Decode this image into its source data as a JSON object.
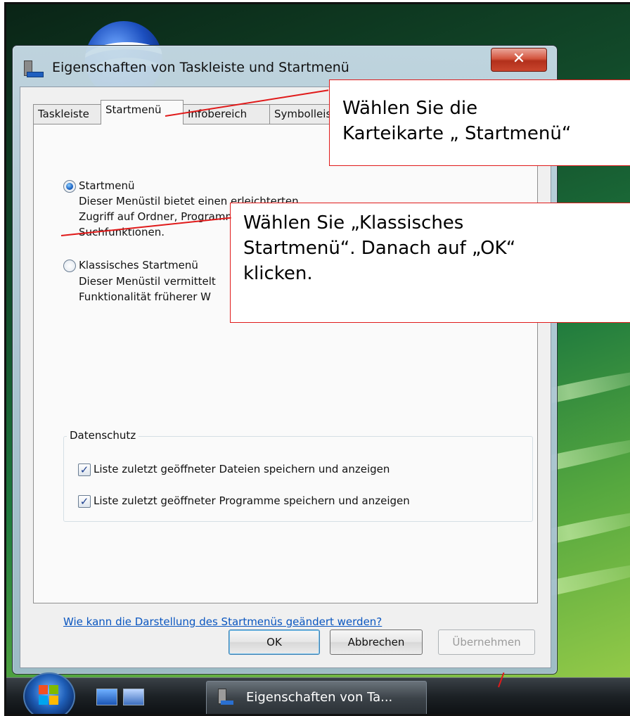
{
  "window": {
    "title": "Eigenschaften von Taskleiste und Startmenü",
    "close_glyph": "✕"
  },
  "tabs": [
    {
      "label": "Taskleiste",
      "active": false
    },
    {
      "label": "Startmenü",
      "active": true
    },
    {
      "label": "Infobereich",
      "active": false
    },
    {
      "label": "Symbolleisten",
      "active": false
    }
  ],
  "options": {
    "startmenu": {
      "label": "Startmenü",
      "selected": true,
      "desc": [
        "Dieser Menüstil bietet einen erleichterten",
        "Zugriff auf Ordner, Programmfavoriten und",
        "Suchfunktionen."
      ]
    },
    "classic": {
      "label": "Klassisches Startmenü",
      "selected": false,
      "desc": [
        "Dieser Menüstil vermittelt",
        "Funktionalität früherer W"
      ]
    }
  },
  "privacy": {
    "legend": "Datenschutz",
    "items": [
      {
        "label": "Liste zuletzt geöffneter Dateien speichern und anzeigen",
        "checked": true
      },
      {
        "label": "Liste zuletzt geöffneter Programme speichern und anzeigen",
        "checked": true
      }
    ]
  },
  "help_link": "Wie kann die Darstellung des Startmenüs geändert werden?",
  "buttons": {
    "ok": "OK",
    "cancel": "Abbrechen",
    "apply": "Übernehmen"
  },
  "callouts": {
    "tab_hint": [
      "Wählen Sie die",
      "Karteikarte „ Startmenü“"
    ],
    "classic_hint": [
      "Wählen Sie  „Klassisches",
      "Startmenü“. Danach auf „OK“",
      "klicken."
    ]
  },
  "taskbar": {
    "task_label": "Eigenschaften von Ta..."
  },
  "colors": {
    "callout_border": "#e01a1a",
    "link": "#0a56c0",
    "close_button": "#c9452d"
  }
}
